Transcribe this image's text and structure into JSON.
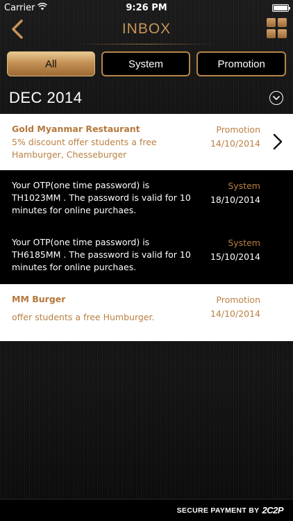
{
  "status_bar": {
    "carrier": "Carrier",
    "time": "9:26 PM",
    "battery_level": 1.0
  },
  "nav": {
    "title": "INBOX",
    "back_icon": "chevron-left-icon",
    "menu_icon": "grid-menu-icon"
  },
  "tabs": [
    {
      "label": "All",
      "active": true
    },
    {
      "label": "System",
      "active": false
    },
    {
      "label": "Promotion",
      "active": false
    }
  ],
  "section": {
    "title": "DEC 2014",
    "toggle_icon": "chevron-down-circle-icon"
  },
  "messages": [
    {
      "title": "Gold Myanmar Restaurant",
      "body": "5% discount offer students a free Hamburger, Chesseburger",
      "category": "Promotion",
      "date": "14/10/2014",
      "has_chevron": true
    },
    {
      "title": "",
      "body": "Your OTP(one time password) is TH1023MM . The password is valid for 10 minutes for online purchaes.",
      "category": "System",
      "date": "18/10/2014",
      "has_chevron": false
    },
    {
      "title": "",
      "body": "Your OTP(one time password) is TH6185MM . The password is valid for 10 minutes for online purchaes.",
      "category": "System",
      "date": "15/10/2014",
      "has_chevron": false
    },
    {
      "title": "MM Burger",
      "body": "offer students a free Humburger.",
      "category": "Promotion",
      "date": "14/10/2014",
      "has_chevron": false
    }
  ],
  "footer": {
    "text": "SECURE PAYMENT BY",
    "logo": "2C2P"
  },
  "colors": {
    "accent_gold": "#c8935a",
    "text_gold": "#b98042",
    "light_row": "#ffffff",
    "dark_row": "#000000"
  }
}
